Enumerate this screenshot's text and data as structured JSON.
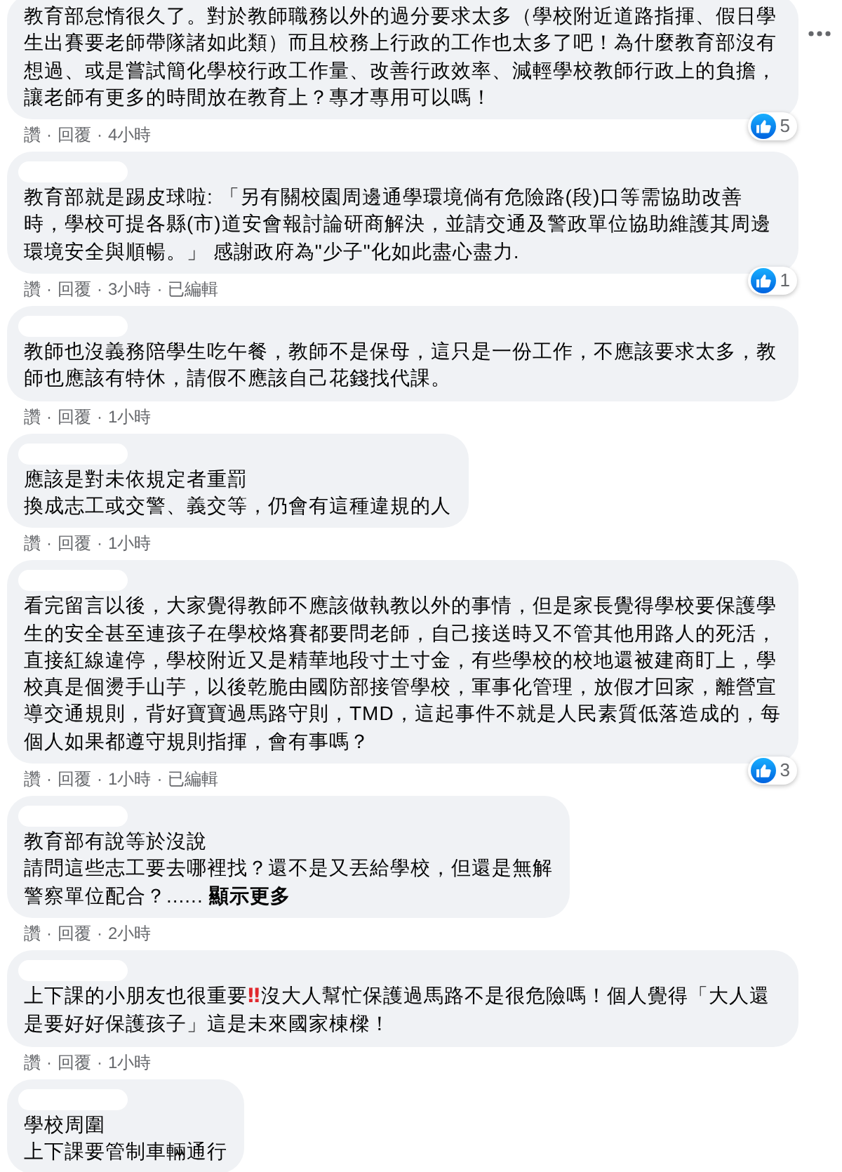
{
  "comments": [
    {
      "name_hidden": false,
      "more_button": true,
      "lines": [
        "教育部怠惰很久了。對於教師職務以外的過分要求太多（學校附近道路指揮、假日學生出賽要老師帶隊諸如此類）而且校務上行政的工作也太多了吧！為什麼教育部沒有想過、或是嘗試簡化學校行政工作量、改善行政效率、減輕學校教師行政上的負擔，讓老師有更多的時間放在教育上？專才專用可以嗎！"
      ],
      "reaction_count": "5",
      "meta": {
        "like": "讚",
        "reply": "回覆",
        "time": "4小時",
        "separators": [
          "·",
          "·"
        ]
      }
    },
    {
      "name_hidden": true,
      "more_button": false,
      "lines": [
        "教育部就是踢皮球啦: 「另有關校園周邊通學環境倘有危險路(段)口等需協助改善時，學校可提各縣(市)道安會報討論研商解決，並請交通及警政單位協助維護其周邊環境安全與順暢。」 感謝政府為\"少子\"化如此盡心盡力."
      ],
      "reaction_count": "1",
      "meta": {
        "like": "讚",
        "reply": "回覆",
        "time": "3小時",
        "edited": "已編輯",
        "separators": [
          "·",
          "·",
          "·"
        ]
      }
    },
    {
      "name_hidden": true,
      "more_button": false,
      "lines": [
        "教師也沒義務陪學生吃午餐，教師不是保母，這只是一份工作，不應該要求太多，教師也應該有特休，請假不應該自己花錢找代課。"
      ],
      "meta": {
        "like": "讚",
        "reply": "回覆",
        "time": "1小時",
        "separators": [
          "·",
          "·"
        ]
      }
    },
    {
      "name_hidden": true,
      "more_button": false,
      "lines": [
        "應該是對未依規定者重罰",
        "換成志工或交警、義交等，仍會有這種違規的人"
      ],
      "meta": {
        "like": "讚",
        "reply": "回覆",
        "time": "1小時",
        "separators": [
          "·",
          "·"
        ]
      }
    },
    {
      "name_hidden": true,
      "more_button": false,
      "lines": [
        "看完留言以後，大家覺得教師不應該做執教以外的事情，但是家長覺得學校要保護學生的安全甚至連孩子在學校烙賽都要問老師，自己接送時又不管其他用路人的死活，直接紅線違停，學校附近又是精華地段寸土寸金，有些學校的校地還被建商盯上，學校真是個燙手山芋，以後乾脆由國防部接管學校，軍事化管理，放假才回家，離營宣導交通規則，背好寶寶過馬路守則，TMD，這起事件不就是人民素質低落造成的，每個人如果都遵守規則指揮，會有事嗎？"
      ],
      "reaction_count": "3",
      "meta": {
        "like": "讚",
        "reply": "回覆",
        "time": "1小時",
        "edited": "已編輯",
        "separators": [
          "·",
          "·",
          "·"
        ]
      }
    },
    {
      "name_hidden": true,
      "more_button": false,
      "lines": [
        "教育部有說等於沒說",
        "請問這些志工要去哪裡找？還不是又丟給學校，但還是無解",
        "警察單位配合？......"
      ],
      "see_more": "顯示更多",
      "meta": {
        "like": "讚",
        "reply": "回覆",
        "time": "2小時",
        "separators": [
          "·",
          "·"
        ]
      }
    },
    {
      "name_hidden": true,
      "more_button": false,
      "text_parts": [
        {
          "kind": "text",
          "text": "上下課的小朋友也很重要"
        },
        {
          "kind": "emoji",
          "text": "‼"
        },
        {
          "kind": "text",
          "text": "沒大人幫忙保護過馬路不是很危險嗎！個人覺得「大人還是要好好保護孩子」這是未來國家棟樑！"
        }
      ],
      "meta": {
        "like": "讚",
        "reply": "回覆",
        "time": "1小時",
        "separators": [
          "·",
          "·"
        ]
      }
    },
    {
      "name_hidden": true,
      "more_button": false,
      "lines": [
        "學校周圍",
        "上下課要管制車輛通行"
      ]
    }
  ]
}
